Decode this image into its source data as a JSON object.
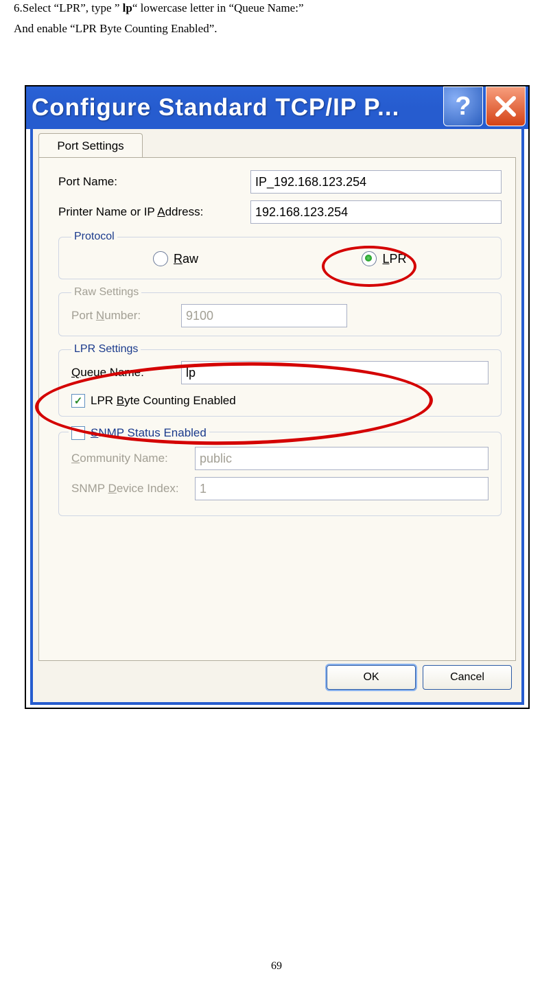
{
  "intro": {
    "line1_prefix": "6.Select “LPR”, type ” ",
    "line1_bold": "lp",
    "line1_suffix": "“ lowercase letter in “Queue Name:”",
    "line2": "And enable “LPR Byte Counting Enabled”."
  },
  "page_number": "69",
  "dialog": {
    "title": "Configure Standard TCP/IP P...",
    "tab_label": "Port Settings",
    "port_name_label": "Port Name:",
    "port_name_value": "IP_192.168.123.254",
    "address_label_prefix": "Printer Name or IP ",
    "address_label_u": "A",
    "address_label_suffix": "ddress:",
    "address_value": "192.168.123.254",
    "protocol_legend": "Protocol",
    "raw_u": "R",
    "raw_suffix": "aw",
    "lpr_u": "L",
    "lpr_suffix": "PR",
    "raw_settings_legend": "Raw Settings",
    "port_number_label_prefix": "Port ",
    "port_number_label_u": "N",
    "port_number_label_suffix": "umber:",
    "port_number_value": "9100",
    "lpr_settings_legend": "LPR Settings",
    "queue_label_u": "Q",
    "queue_label_suffix": "ueue Name:",
    "queue_value": "lp",
    "byte_count_prefix": "LPR ",
    "byte_count_u": "B",
    "byte_count_suffix": "yte Counting Enabled",
    "snmp_label_u": "S",
    "snmp_label_suffix": "NMP Status Enabled",
    "community_label_u": "C",
    "community_label_suffix": "ommunity Name:",
    "community_value": "public",
    "device_idx_prefix": "SNMP ",
    "device_idx_u": "D",
    "device_idx_suffix": "evice Index:",
    "device_idx_value": "1",
    "ok_label": "OK",
    "cancel_label": "Cancel"
  }
}
